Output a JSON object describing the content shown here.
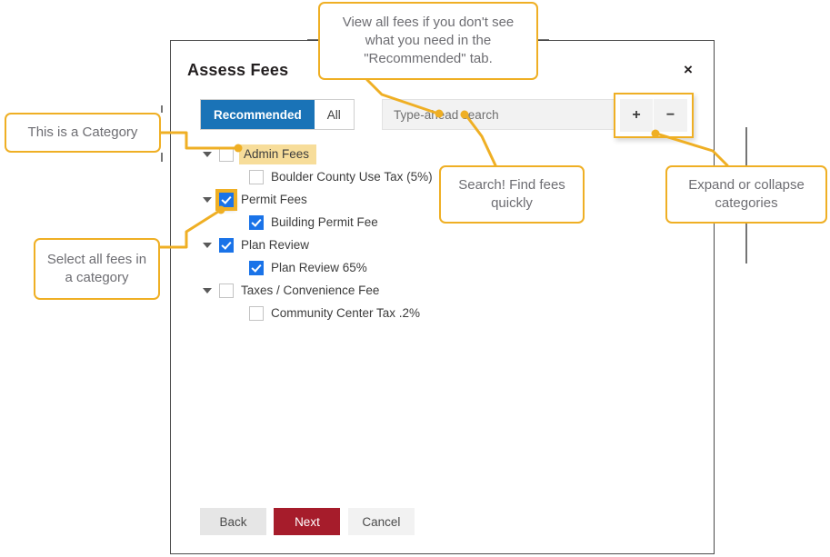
{
  "modal": {
    "title": "Assess Fees",
    "close_icon": "close-icon",
    "close_label": "×"
  },
  "toolbar": {
    "tabs": [
      {
        "label": "Recommended",
        "active": true
      },
      {
        "label": "All",
        "active": false
      }
    ],
    "search": {
      "placeholder": "Type-ahead search",
      "value": ""
    },
    "expand_label": "+",
    "collapse_label": "−",
    "expand_icon": "plus-icon",
    "collapse_icon": "minus-icon"
  },
  "tree": {
    "nodes": [
      {
        "label": "Admin Fees",
        "level": 0,
        "checked": false,
        "caret": true,
        "highlight_label": true,
        "highlight_checkbox": false
      },
      {
        "label": "Boulder County Use Tax (5%)",
        "level": 1,
        "checked": false,
        "caret": false,
        "highlight_label": false,
        "highlight_checkbox": false
      },
      {
        "label": "Permit Fees",
        "level": 0,
        "checked": true,
        "caret": true,
        "highlight_label": false,
        "highlight_checkbox": true
      },
      {
        "label": "Building Permit Fee",
        "level": 1,
        "checked": true,
        "caret": false,
        "highlight_label": false,
        "highlight_checkbox": false
      },
      {
        "label": "Plan Review",
        "level": 0,
        "checked": true,
        "caret": true,
        "highlight_label": false,
        "highlight_checkbox": false
      },
      {
        "label": "Plan Review 65%",
        "level": 1,
        "checked": true,
        "caret": false,
        "highlight_label": false,
        "highlight_checkbox": false
      },
      {
        "label": "Taxes / Convenience Fee",
        "level": 0,
        "checked": false,
        "caret": true,
        "highlight_label": false,
        "highlight_checkbox": false
      },
      {
        "label": "Community Center Tax .2%",
        "level": 1,
        "checked": false,
        "caret": false,
        "highlight_label": false,
        "highlight_checkbox": false
      }
    ]
  },
  "footer": {
    "back_label": "Back",
    "next_label": "Next",
    "cancel_label": "Cancel"
  },
  "annotations": [
    {
      "id": "view-all",
      "text": "View all fees if you don't see what you need in the \"Recommended\" tab."
    },
    {
      "id": "category",
      "text": "This is a Category"
    },
    {
      "id": "search",
      "text": "Search! Find fees quickly"
    },
    {
      "id": "expand",
      "text": "Expand or collapse categories"
    },
    {
      "id": "select-all",
      "text": "Select all fees in a category"
    }
  ],
  "colors": {
    "accent_blue": "#1a73e8",
    "tab_blue": "#1a73b7",
    "callout_gold": "#efaf24",
    "highlight_gold": "#f7dd9a",
    "next_red": "#a61c2b"
  }
}
